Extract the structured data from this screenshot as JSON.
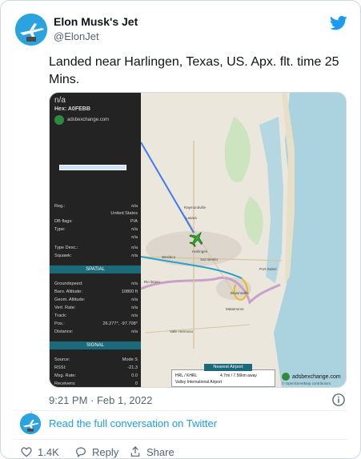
{
  "author": {
    "name": "Elon Musk's Jet",
    "handle": "@ElonJet"
  },
  "tweet": {
    "text": "Landed near Harlingen, Texas, US. Apx. flt. time 25 Mins.",
    "timestamp": "9:21 PM · Feb 1, 2022"
  },
  "media": {
    "panel": {
      "title": "n/a",
      "hex_label": "Hex:",
      "hex_value": "A0FEBB",
      "site": "adsbexchange.com",
      "rows1": [
        {
          "k": "Reg.:",
          "v": "n/a"
        },
        {
          "k": "",
          "v": "United States"
        },
        {
          "k": "DB flags:",
          "v": "P/A"
        },
        {
          "k": "Type:",
          "v": "n/a"
        },
        {
          "k": "",
          "v": "n/a"
        },
        {
          "k": "Type Desc.:",
          "v": "n/a"
        },
        {
          "k": "Squawk:",
          "v": "n/a"
        }
      ],
      "section_spatial": "SPATIAL",
      "rows2": [
        {
          "k": "Groundspeed:",
          "v": "n/a"
        },
        {
          "k": "Baro. Altitude:",
          "v": "10800 ft"
        },
        {
          "k": "Geom. Altitude:",
          "v": "n/a"
        },
        {
          "k": "Vert. Rate:",
          "v": "n/a"
        },
        {
          "k": "Track:",
          "v": "n/a"
        },
        {
          "k": "Pos.:",
          "v": "26.277°, -97.708°"
        },
        {
          "k": "Distance:",
          "v": "n/a"
        }
      ],
      "section_signal": "SIGNAL",
      "rows3": [
        {
          "k": "Source:",
          "v": "Mode S"
        },
        {
          "k": "RSSI:",
          "v": "-21.3"
        },
        {
          "k": "Msg. Rate:",
          "v": "0.0"
        },
        {
          "k": "Receivers:",
          "v": "0"
        }
      ]
    },
    "nearest": {
      "header": "Nearest Airport",
      "code": "HRL / KHRL",
      "distance": "4.7mi / 7.56km away",
      "airport": "Valley International Airport"
    },
    "brand": "adsbexchange.com",
    "attribution": "© OpenStreetMap contributors",
    "map_labels": [
      "Raymondville",
      "Lasara",
      "Harlingen",
      "San Benito",
      "Weslaco",
      "Brownsville",
      "Matamoros",
      "Valle Hermoso",
      "Port Isabel",
      "Rio Bravo"
    ]
  },
  "footer": {
    "read_link": "Read the full conversation on Twitter",
    "like_count": "1.4K",
    "reply_label": "Reply",
    "share_label": "Share"
  },
  "colors": {
    "accent": "#1d9bf0",
    "panel": "#232323",
    "section": "#1a6a7a"
  }
}
